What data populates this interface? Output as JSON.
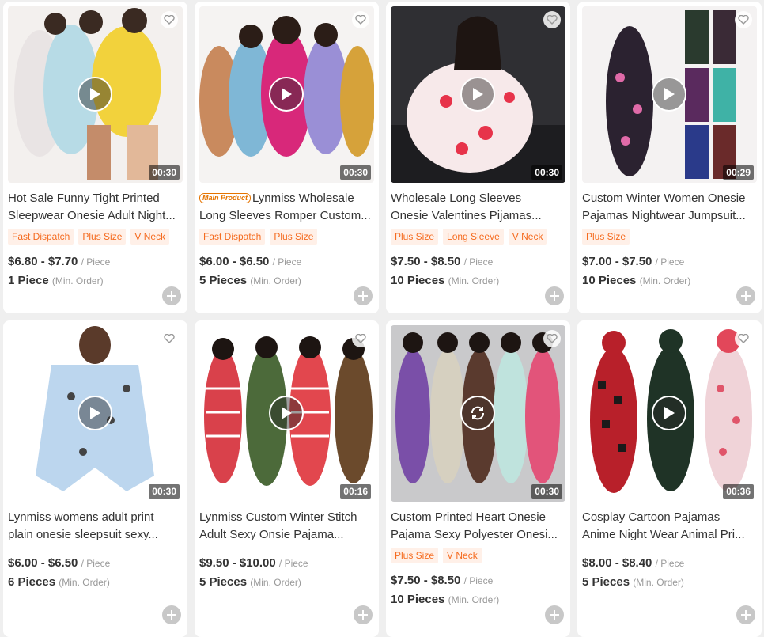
{
  "colors": {
    "accent": "#f56b1f",
    "tag_bg": "#fff0e8",
    "page_bg": "#efefef",
    "text": "#333333",
    "muted": "#999999"
  },
  "labels": {
    "unit": "/ Piece",
    "min_order": "(Min. Order)",
    "main_product_badge": "Main Product"
  },
  "products": [
    {
      "title_lines": [
        "Hot Sale Funny Tight Printed",
        "Sleepwear Onesie Adult Night..."
      ],
      "badge": "",
      "tags": [
        "Fast Dispatch",
        "Plus Size",
        "V Neck"
      ],
      "price": "$6.80 - $7.70",
      "moq": "1 Piece",
      "duration": "00:30",
      "media_icon": "play-icon"
    },
    {
      "title_lines": [
        "Lynmiss Wholesale",
        "Long Sleeves Romper Custom..."
      ],
      "badge": "Main Product",
      "tags": [
        "Fast Dispatch",
        "Plus Size"
      ],
      "price": "$6.00 - $6.50",
      "moq": "5 Pieces",
      "duration": "00:30",
      "media_icon": "play-icon"
    },
    {
      "title_lines": [
        "Wholesale Long Sleeves",
        "Onesie Valentines Pijamas..."
      ],
      "badge": "",
      "tags": [
        "Plus Size",
        "Long Sleeve",
        "V Neck"
      ],
      "price": "$7.50 - $8.50",
      "moq": "10 Pieces",
      "duration": "00:30",
      "media_icon": "play-icon"
    },
    {
      "title_lines": [
        "Custom Winter Women Onesie",
        "Pajamas Nightwear Jumpsuit..."
      ],
      "badge": "",
      "tags": [
        "Plus Size"
      ],
      "price": "$7.00 - $7.50",
      "moq": "10 Pieces",
      "duration": "00:29",
      "media_icon": "play-icon"
    },
    {
      "title_lines": [
        "Lynmiss womens adult print",
        "plain onesie sleepsuit sexy..."
      ],
      "badge": "",
      "tags": [],
      "price": "$6.00 - $6.50",
      "moq": "6 Pieces",
      "duration": "00:30",
      "media_icon": "play-icon"
    },
    {
      "title_lines": [
        "Lynmiss Custom Winter Stitch",
        "Adult Sexy Onsie Pajama..."
      ],
      "badge": "",
      "tags": [],
      "price": "$9.50 - $10.00",
      "moq": "5 Pieces",
      "duration": "00:16",
      "media_icon": "play-icon"
    },
    {
      "title_lines": [
        "Custom Printed Heart Onesie",
        "Pajama Sexy Polyester Onesi..."
      ],
      "badge": "",
      "tags": [
        "Plus Size",
        "V Neck"
      ],
      "price": "$7.50 - $8.50",
      "moq": "10 Pieces",
      "duration": "00:30",
      "media_icon": "loading-icon"
    },
    {
      "title_lines": [
        "Cosplay Cartoon Pajamas",
        "Anime Night Wear Animal Pri..."
      ],
      "badge": "",
      "tags": [],
      "price": "$8.00 - $8.40",
      "moq": "5 Pieces",
      "duration": "00:36",
      "media_icon": "play-icon"
    }
  ]
}
